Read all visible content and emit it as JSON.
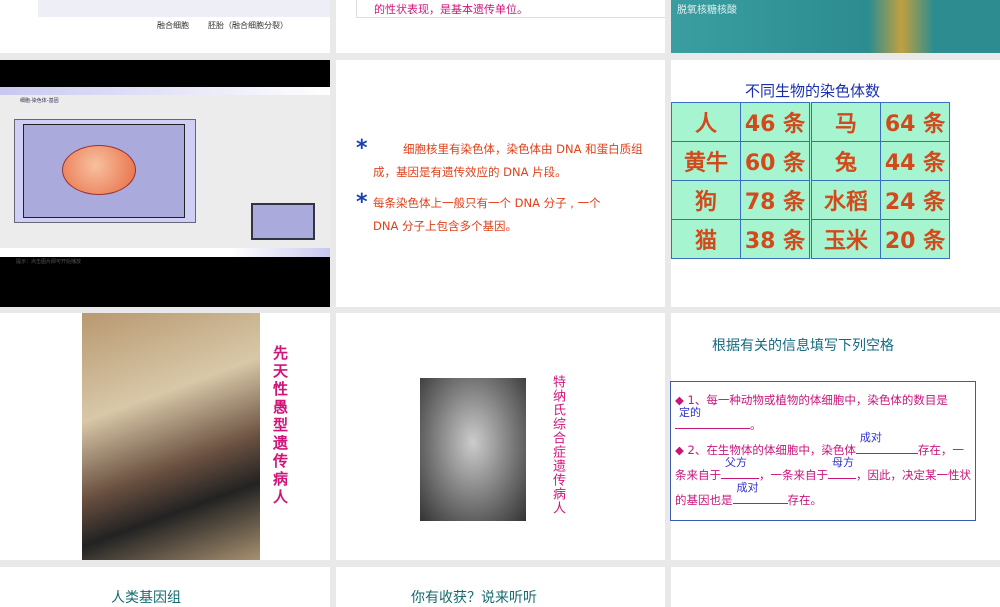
{
  "slide1": {
    "caption_left": "融合细胞",
    "caption_right": "胚胎（融合细胞分裂）"
  },
  "slide2": {
    "text": "的性状表现，是基本遗传单位。"
  },
  "slide3": {
    "label": "脱氧核糖核酸"
  },
  "slide4": {
    "title": "细胞-染色体-基因",
    "status": "提示：点击图片即可开始播放"
  },
  "slide5": {
    "bullet_icon": "*",
    "p1": "细胞核里有染色体，染色体由 DNA 和蛋白质组成，基因是有遗传效应的 DNA 片段。",
    "p2": "每条染色体上一般只有一个 DNA 分子 , 一个 DNA 分子上包含多个基因。"
  },
  "slide6": {
    "title": "不同生物的染色体数",
    "rows": [
      [
        "人",
        "46 条",
        "马",
        "64 条"
      ],
      [
        "黄牛",
        "60 条",
        "兔",
        "44 条"
      ],
      [
        "狗",
        "78 条",
        "水稻",
        "24 条"
      ],
      [
        "猫",
        "38 条",
        "玉米",
        "20 条"
      ]
    ]
  },
  "slide7": {
    "caption": "先天性愚型遗传病人"
  },
  "slide8": {
    "caption": "特纳氏综合症遗传病人"
  },
  "slide9": {
    "title": "根据有关的信息填写下列空格",
    "q1a": "1、每一种动物或植物的体细胞中，染色体的数目是",
    "q1ans": "定的",
    "q1b": "。",
    "q2a": "2、在生物体的体细胞中，染色体",
    "q2ans1": "成对",
    "q2b": "存在，一条来自于",
    "q2ans2": "父方",
    "q2c": "，一条来自于",
    "q2ans3": "母方",
    "q2d": "，因此，决定某一性状的基因也是",
    "q2ans4": "成对",
    "q2e": "存在。"
  },
  "slide10": {
    "title": "人类基因组"
  },
  "slide11": {
    "title": "你有收获？说来听听"
  }
}
